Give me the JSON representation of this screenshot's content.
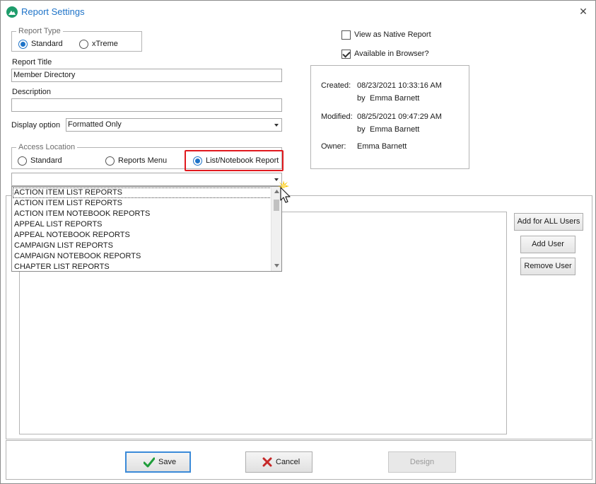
{
  "window": {
    "title": "Report Settings",
    "close_glyph": "✕"
  },
  "report_type": {
    "legend": "Report Type",
    "options": [
      {
        "label": "Standard",
        "checked": true
      },
      {
        "label": "xTreme",
        "checked": false
      }
    ]
  },
  "report_title": {
    "label": "Report Title",
    "value": "Member Directory"
  },
  "description": {
    "label": "Description",
    "value": ""
  },
  "display_option": {
    "label": "Display option",
    "value": "Formatted Only"
  },
  "access_location": {
    "legend": "Access Location",
    "options": [
      {
        "label": "Standard",
        "checked": false
      },
      {
        "label": "Reports Menu",
        "checked": false
      },
      {
        "label": "List/Notebook Report",
        "checked": true
      }
    ],
    "combo_value": ""
  },
  "options": {
    "view_native": {
      "label": "View as Native Report",
      "checked": false
    },
    "available_browser": {
      "label": "Available in Browser?",
      "checked": true
    }
  },
  "info": {
    "created_label": "Created:",
    "created_value": "08/23/2021 10:33:16 AM",
    "created_by_prefix": "by",
    "created_by": "Emma Barnett",
    "modified_label": "Modified:",
    "modified_value": "08/25/2021 09:47:29 AM",
    "modified_by_prefix": "by",
    "modified_by": "Emma Barnett",
    "owner_label": "Owner:",
    "owner_value": "Emma Barnett"
  },
  "dropdown": {
    "items": [
      "ACTION ITEM LIST REPORTS",
      "ACTION ITEM LIST REPORTS",
      "ACTION ITEM NOTEBOOK REPORTS",
      "APPEAL LIST REPORTS",
      "APPEAL NOTEBOOK REPORTS",
      "CAMPAIGN LIST REPORTS",
      "CAMPAIGN NOTEBOOK REPORTS",
      "CHAPTER LIST REPORTS"
    ]
  },
  "user_buttons": {
    "add_all": "Add for ALL Users",
    "add_user": "Add User",
    "remove_user": "Remove User"
  },
  "footer": {
    "save": "Save",
    "cancel": "Cancel",
    "design": "Design"
  },
  "colors": {
    "accent": "#1e73c8",
    "highlight": "#e0191e",
    "save_check": "#1f9d3a",
    "cancel_x": "#c62828"
  }
}
